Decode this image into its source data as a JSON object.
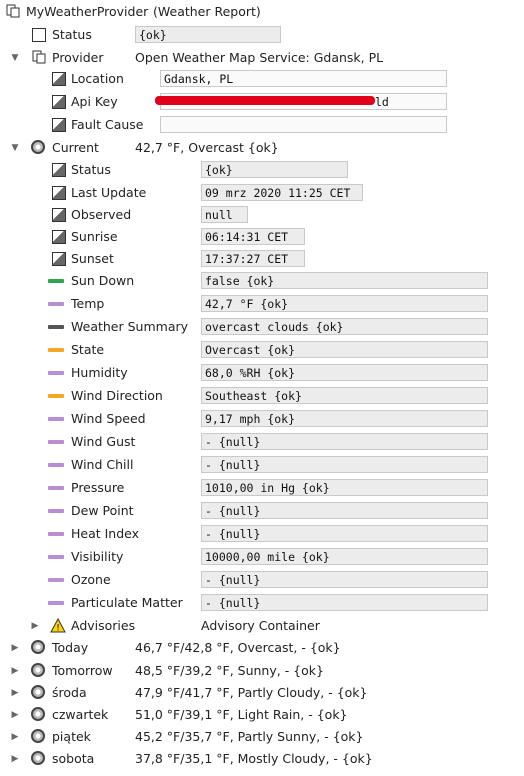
{
  "root": {
    "title": "MyWeatherProvider",
    "subtitle": "(Weather Report)"
  },
  "status": {
    "label": "Status",
    "value": "{ok}"
  },
  "provider": {
    "label": "Provider",
    "value": "Open Weather Map Service: Gdansk, PL"
  },
  "provider_props": [
    {
      "label": "Location",
      "value": "Gdansk, PL"
    },
    {
      "label": "Api Key",
      "value": "ld"
    },
    {
      "label": "Fault Cause",
      "value": ""
    }
  ],
  "current": {
    "label": "Current",
    "value": "42,7 °F, Overcast {ok}"
  },
  "current_props": [
    {
      "label": "Status",
      "value": "{ok}"
    },
    {
      "label": "Last Update",
      "value": "09 mrz 2020 11:25 CET"
    },
    {
      "label": "Observed",
      "value": "null"
    },
    {
      "label": "Sunrise",
      "value": "06:14:31 CET"
    },
    {
      "label": "Sunset",
      "value": "17:37:27 CET"
    }
  ],
  "current_points": [
    {
      "label": "Sun Down",
      "value": "false {ok}",
      "color": "#2ea44f"
    },
    {
      "label": "Temp",
      "value": "42,7 °F {ok}",
      "color": "#b98fd4"
    },
    {
      "label": "Weather Summary",
      "value": "overcast clouds {ok}",
      "color": "#555555"
    },
    {
      "label": "State",
      "value": "Overcast {ok}",
      "color": "#f5a623"
    },
    {
      "label": "Humidity",
      "value": "68,0 %RH {ok}",
      "color": "#b98fd4"
    },
    {
      "label": "Wind Direction",
      "value": "Southeast {ok}",
      "color": "#f5a623"
    },
    {
      "label": "Wind Speed",
      "value": "9,17 mph {ok}",
      "color": "#b98fd4"
    },
    {
      "label": "Wind Gust",
      "value": "- {null}",
      "color": "#b98fd4"
    },
    {
      "label": "Wind Chill",
      "value": "- {null}",
      "color": "#b98fd4"
    },
    {
      "label": "Pressure",
      "value": "1010,00 in Hg {ok}",
      "color": "#b98fd4"
    },
    {
      "label": "Dew Point",
      "value": "- {null}",
      "color": "#b98fd4"
    },
    {
      "label": "Heat Index",
      "value": "- {null}",
      "color": "#b98fd4"
    },
    {
      "label": "Visibility",
      "value": "10000,00 mile {ok}",
      "color": "#b98fd4"
    },
    {
      "label": "Ozone",
      "value": "- {null}",
      "color": "#b98fd4"
    },
    {
      "label": "Particulate Matter",
      "value": "- {null}",
      "color": "#b98fd4"
    }
  ],
  "advisories": {
    "label": "Advisories",
    "value": "Advisory Container"
  },
  "forecast": [
    {
      "label": "Today",
      "value": "46,7 °F/42,8 °F, Overcast, - {ok}"
    },
    {
      "label": "Tomorrow",
      "value": "48,5 °F/39,2 °F, Sunny, - {ok}"
    },
    {
      "label": "środa",
      "value": "47,9 °F/41,7 °F, Partly Cloudy, - {ok}"
    },
    {
      "label": "czwartek",
      "value": "51,0 °F/39,1 °F, Light Rain, - {ok}"
    },
    {
      "label": "piątek",
      "value": "45,2 °F/35,7 °F, Partly Sunny, - {ok}"
    },
    {
      "label": "sobota",
      "value": "37,8 °F/35,1 °F, Mostly Cloudy, - {ok}"
    }
  ]
}
